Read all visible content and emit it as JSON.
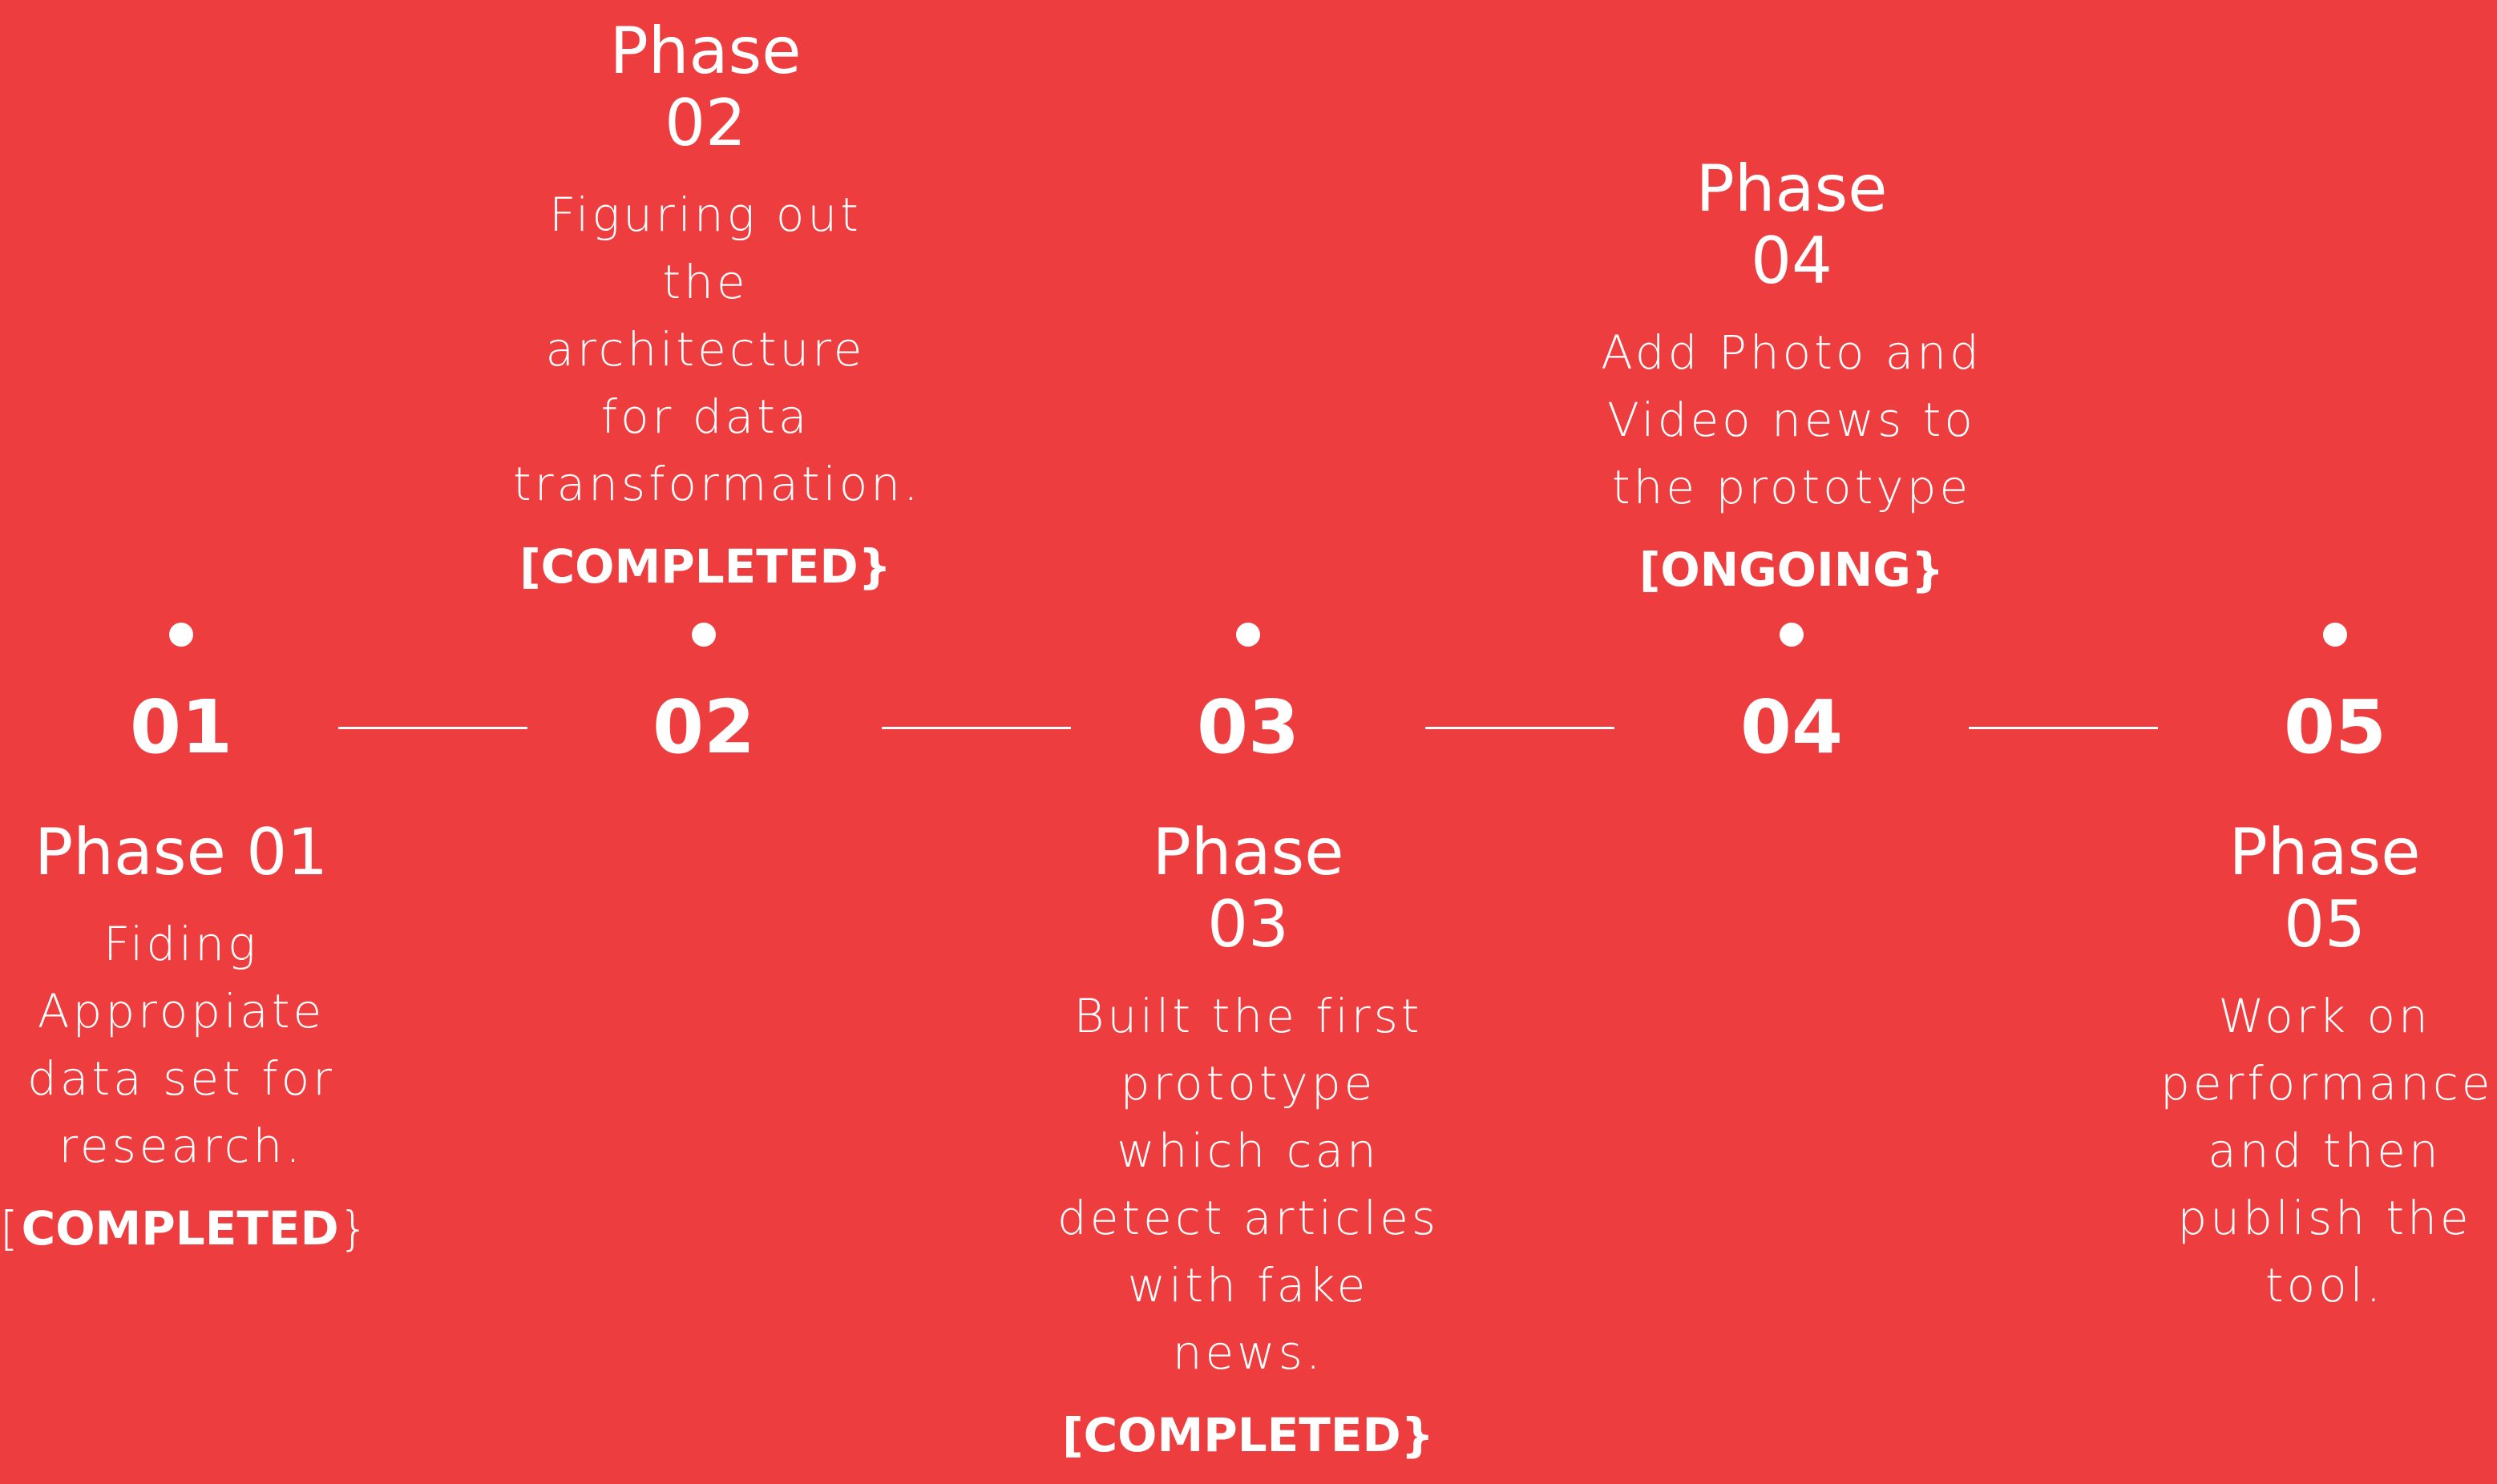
{
  "numbers": [
    "01",
    "02",
    "03",
    "04",
    "05"
  ],
  "phases": [
    {
      "title": "Phase 01",
      "description": "Fiding\nAppropiate\ndata set for\nresearch.",
      "status_open": "[",
      "status_word": "COMPLETED",
      "status_close": "}"
    },
    {
      "title": "Phase\n02",
      "description": "Figuring out\nthe\narchitecture\nfor data\ntransformation.",
      "status": "[COMPLETED}"
    },
    {
      "title": "Phase\n03",
      "description": "Built the first\nprototype\nwhich can\ndetect articles\nwith fake\nnews.",
      "status": "[COMPLETED}"
    },
    {
      "title": "Phase\n04",
      "description": "Add Photo and\nVideo news to\nthe prototype",
      "status": "[ONGOING}"
    },
    {
      "title": "Phase\n05",
      "description": "Work on\nperformance\nand then\npublish the\ntool."
    }
  ],
  "colors": {
    "background": "#ed3d3f",
    "foreground": "#ffffff"
  }
}
